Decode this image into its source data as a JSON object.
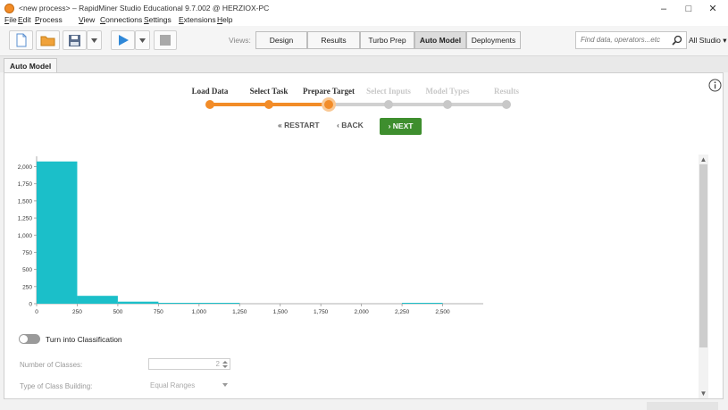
{
  "window": {
    "title": "<new process> – RapidMiner Studio Educational 9.7.002 @ HERZIOX-PC",
    "minimize": "–",
    "maximize": "□",
    "close": "✕"
  },
  "menu": [
    "File",
    "Edit",
    "Process",
    "View",
    "Connections",
    "Settings",
    "Extensions",
    "Help"
  ],
  "toolbar": {
    "views_label": "Views:",
    "views": [
      "Design",
      "Results",
      "Turbo Prep",
      "Auto Model",
      "Deployments"
    ],
    "active_view": "Auto Model",
    "search_placeholder": "Find data, operators...etc",
    "studio_label": "All Studio ▾"
  },
  "panel": {
    "tab": "Auto Model"
  },
  "wizard": {
    "steps": [
      {
        "label": "Load Data",
        "state": "done"
      },
      {
        "label": "Select Task",
        "state": "done"
      },
      {
        "label": "Prepare Target",
        "state": "current"
      },
      {
        "label": "Select Inputs",
        "state": "todo"
      },
      {
        "label": "Model Types",
        "state": "todo"
      },
      {
        "label": "Results",
        "state": "todo"
      }
    ],
    "restart_label": "« RESTART",
    "back_label": "‹ BACK",
    "next_label": "› NEXT"
  },
  "colors": {
    "accent": "#f28c28",
    "bar": "#1bbfc9",
    "next": "#3e8e2e"
  },
  "chart_data": {
    "type": "bar",
    "x_ticks": [
      "0",
      "250",
      "500",
      "750",
      "1,000",
      "1,250",
      "1,500",
      "1,750",
      "2,000",
      "2,250",
      "2,500"
    ],
    "y_ticks": [
      "0",
      "250",
      "500",
      "750",
      "1,000",
      "1,250",
      "1,500",
      "1,750",
      "2,000"
    ],
    "xlim": [
      0,
      2750
    ],
    "ylim": [
      0,
      2150
    ],
    "bins": [
      {
        "x0": 0,
        "x1": 250,
        "value": 2075
      },
      {
        "x0": 250,
        "x1": 500,
        "value": 115
      },
      {
        "x0": 500,
        "x1": 750,
        "value": 30
      },
      {
        "x0": 750,
        "x1": 1000,
        "value": 8
      },
      {
        "x0": 1000,
        "x1": 1250,
        "value": 4
      },
      {
        "x0": 1250,
        "x1": 1500,
        "value": 0
      },
      {
        "x0": 1500,
        "x1": 1750,
        "value": 0
      },
      {
        "x0": 1750,
        "x1": 2000,
        "value": 0
      },
      {
        "x0": 2000,
        "x1": 2250,
        "value": 0
      },
      {
        "x0": 2250,
        "x1": 2500,
        "value": 2
      }
    ]
  },
  "options": {
    "toggle_label": "Turn into Classification",
    "toggle_on": false,
    "num_classes_label": "Number of Classes:",
    "num_classes_value": "2",
    "class_building_label": "Type of Class Building:",
    "class_building_value": "Equal Ranges"
  }
}
